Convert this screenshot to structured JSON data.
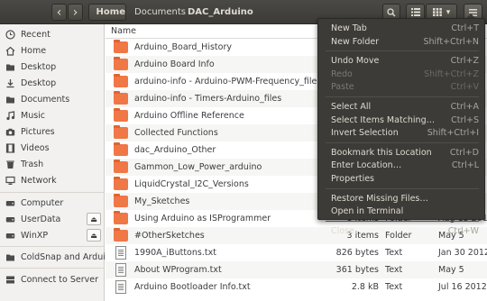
{
  "toolbar": {
    "back": "‹",
    "forward": "›",
    "home_icon": "home-icon",
    "crumbs": [
      "Home",
      "Documents",
      "DAC_Arduino"
    ],
    "search_icon": "search-icon",
    "list_view_icon": "list-view-icon",
    "grid_view_icon": "grid-view-icon",
    "view_options": "▾",
    "menu_icon": "hamburger-icon"
  },
  "sidebar": {
    "items": [
      {
        "label": "Recent",
        "icon": "clock-icon"
      },
      {
        "label": "Home",
        "icon": "home-icon"
      },
      {
        "label": "Desktop",
        "icon": "folder-icon"
      },
      {
        "label": "Desktop",
        "icon": "download-icon"
      },
      {
        "label": "Documents",
        "icon": "folder-icon"
      },
      {
        "label": "Music",
        "icon": "music-icon"
      },
      {
        "label": "Pictures",
        "icon": "camera-icon"
      },
      {
        "label": "Videos",
        "icon": "video-icon"
      },
      {
        "label": "Trash",
        "icon": "trash-icon"
      },
      {
        "label": "Network",
        "icon": "network-icon"
      }
    ],
    "devices": [
      {
        "label": "Computer",
        "icon": "drive-icon",
        "eject": false
      },
      {
        "label": "UserData",
        "icon": "drive-icon",
        "eject": true
      },
      {
        "label": "WinXP",
        "icon": "drive-icon",
        "eject": true
      }
    ],
    "bookmarks": [
      {
        "label": "ColdSnap and Ardui…",
        "icon": "folder-icon"
      }
    ],
    "connect": {
      "label": "Connect to Server",
      "icon": "server-icon"
    },
    "eject_glyph": "⏏"
  },
  "columns": {
    "name": "Name"
  },
  "files": [
    {
      "name": "Arduino_Board_History",
      "kind": "folder",
      "size": "",
      "type": "",
      "date": ""
    },
    {
      "name": "Arduino Board Info",
      "kind": "folder",
      "size": "",
      "type": "",
      "date": ""
    },
    {
      "name": "arduino-info - Arduino-PWM-Frequency_files",
      "kind": "folder",
      "size": "",
      "type": "",
      "date": ""
    },
    {
      "name": "arduino-info - Timers-Arduino_files",
      "kind": "folder",
      "size": "",
      "type": "",
      "date": ""
    },
    {
      "name": "Arduino Offline Reference",
      "kind": "folder",
      "size": "",
      "type": "",
      "date": ""
    },
    {
      "name": "Collected Functions",
      "kind": "folder",
      "size": "",
      "type": "",
      "date": ""
    },
    {
      "name": "dac_Arduino_Other",
      "kind": "folder",
      "size": "",
      "type": "",
      "date": ""
    },
    {
      "name": "Gammon_Low_Power_arduino",
      "kind": "folder",
      "size": "",
      "type": "",
      "date": ""
    },
    {
      "name": "LiquidCrystal_I2C_Versions",
      "kind": "folder",
      "size": "",
      "type": "",
      "date": ""
    },
    {
      "name": "My_Sketches",
      "kind": "folder",
      "size": "",
      "type": "",
      "date": ""
    },
    {
      "name": "Using Arduino as ISProgrammer",
      "kind": "folder",
      "size": "8 items",
      "type": "Folder",
      "date": "Aug 13 2012"
    },
    {
      "name": "#OtherSketches",
      "kind": "folder",
      "size": "3 items",
      "type": "Folder",
      "date": "May 5"
    },
    {
      "name": "1990A_iButtons.txt",
      "kind": "text",
      "size": "826 bytes",
      "type": "Text",
      "date": "Jan 30 2012"
    },
    {
      "name": "About WProgram.txt",
      "kind": "text",
      "size": "361 bytes",
      "type": "Text",
      "date": "May 5"
    },
    {
      "name": "Arduino Bootloader Info.txt",
      "kind": "text",
      "size": "2.8 kB",
      "type": "Text",
      "date": "Jul 16 2012"
    }
  ],
  "menu": {
    "groups": [
      [
        {
          "label": "New Tab",
          "accel": "Ctrl+T",
          "disabled": false
        },
        {
          "label": "New Folder",
          "accel": "Shift+Ctrl+N",
          "disabled": false
        }
      ],
      [
        {
          "label": "Undo Move",
          "accel": "Ctrl+Z",
          "disabled": false
        },
        {
          "label": "Redo",
          "accel": "Shift+Ctrl+Z",
          "disabled": true
        },
        {
          "label": "Paste",
          "accel": "Ctrl+V",
          "disabled": true
        }
      ],
      [
        {
          "label": "Select All",
          "accel": "Ctrl+A",
          "disabled": false
        },
        {
          "label": "Select Items Matching…",
          "accel": "Ctrl+S",
          "disabled": false
        },
        {
          "label": "Invert Selection",
          "accel": "Shift+Ctrl+I",
          "disabled": false
        }
      ],
      [
        {
          "label": "Bookmark this Location",
          "accel": "Ctrl+D",
          "disabled": false
        },
        {
          "label": "Enter Location…",
          "accel": "Ctrl+L",
          "disabled": false
        },
        {
          "label": "Properties",
          "accel": "",
          "disabled": false
        }
      ],
      [
        {
          "label": "Restore Missing Files…",
          "accel": "",
          "disabled": false
        },
        {
          "label": "Open in Terminal",
          "accel": "",
          "disabled": false
        }
      ],
      [
        {
          "label": "Close",
          "accel": "Ctrl+W",
          "disabled": false
        }
      ]
    ]
  },
  "colors": {
    "header": "#3c3b37",
    "sidebar": "#f2f1f0",
    "folder": "#f07746",
    "menu_bg": "#3c3b37",
    "menu_text": "#dfdbd2"
  }
}
